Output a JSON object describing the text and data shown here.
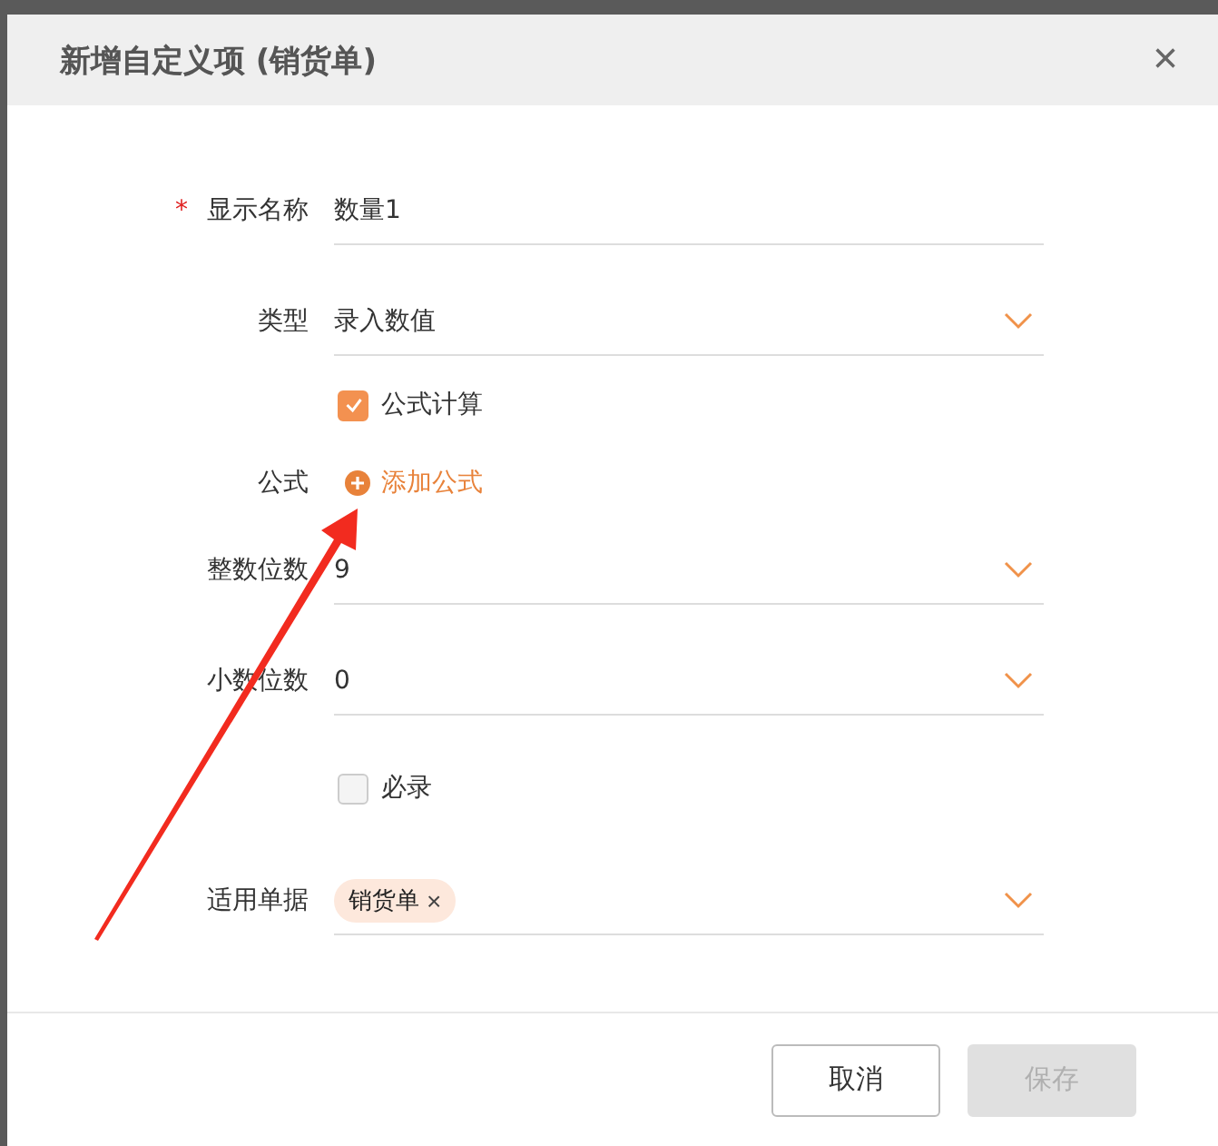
{
  "dialog": {
    "title": "新增自定义项 (销货单)",
    "close_icon": "×"
  },
  "rows": [
    {
      "kind": "text",
      "label": "显示名称",
      "required_mark": "*",
      "value": "数量1"
    },
    {
      "kind": "select",
      "label": "类型",
      "value": "录入数值"
    },
    {
      "kind": "checkbox",
      "label": "公式计算",
      "checked": true
    },
    {
      "kind": "add",
      "label": "公式",
      "action": "添加公式"
    },
    {
      "kind": "select",
      "label": "整数位数",
      "value": "9"
    },
    {
      "kind": "select",
      "label": "小数位数",
      "value": "0"
    },
    {
      "kind": "checkbox",
      "label": "必录",
      "checked": false
    },
    {
      "kind": "tags",
      "label": "适用单据",
      "tags": [
        {
          "text": "销货单",
          "remove": "×"
        }
      ]
    }
  ],
  "buttons": [
    {
      "label": "取消",
      "disabled": false
    },
    {
      "label": "保存",
      "disabled": true
    }
  ]
}
